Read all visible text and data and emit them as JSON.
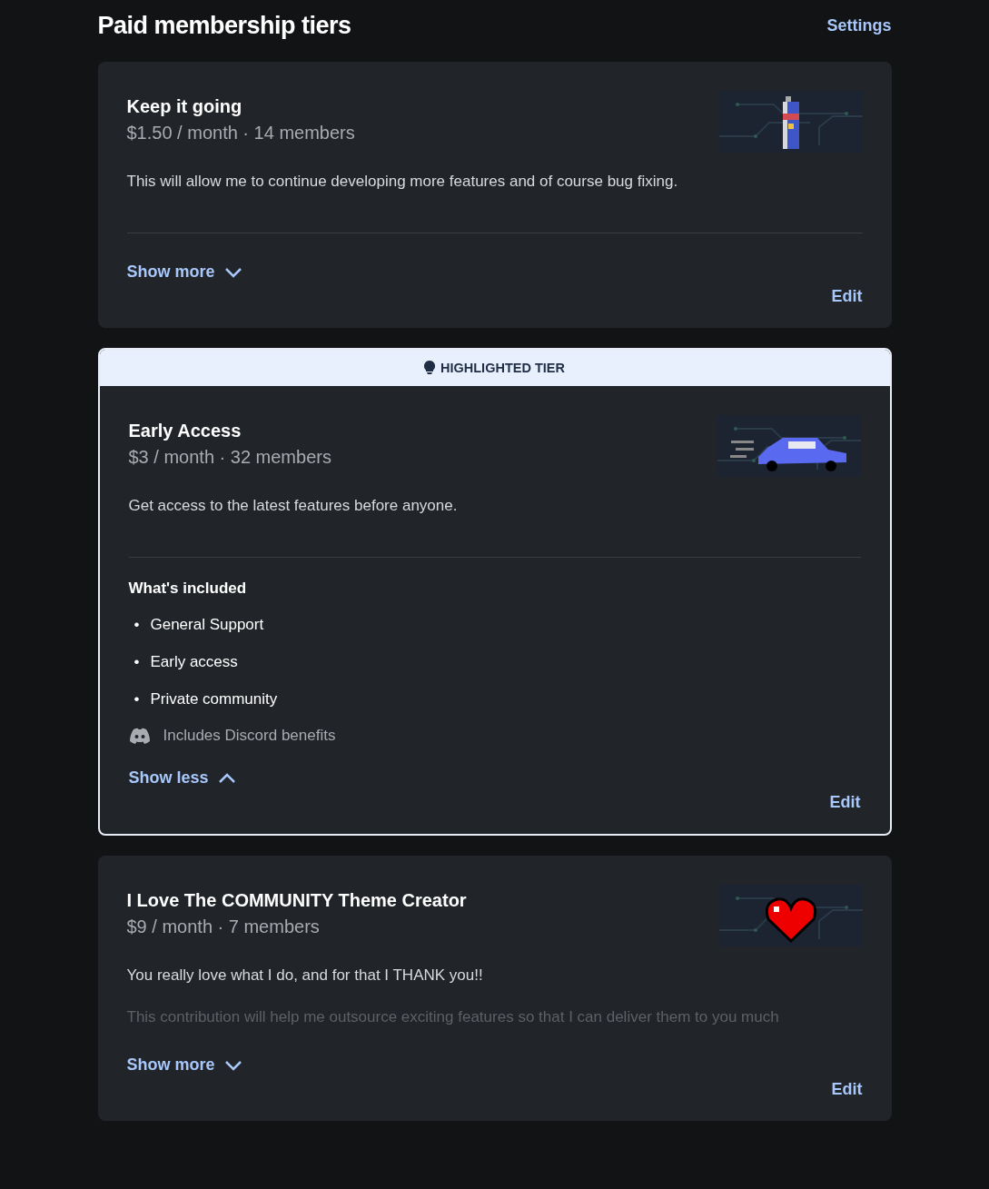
{
  "header": {
    "title": "Paid membership tiers",
    "settings_link": "Settings"
  },
  "tiers": [
    {
      "name": "Keep it going",
      "price": "$1.50 / month · 14 members",
      "description": "This will allow me to continue developing more features and of course bug fixing.",
      "highlighted": false,
      "expanded": false,
      "toggle": "Show more",
      "edit": "Edit"
    },
    {
      "highlight_label": "HIGHLIGHTED TIER",
      "name": "Early Access",
      "price": "$3 / month · 32 members",
      "description": "Get access to the latest features before anyone.",
      "highlighted": true,
      "expanded": true,
      "included_title": "What's included",
      "included": [
        {
          "bullet": "•",
          "text": "General Support"
        },
        {
          "bullet": "•",
          "text": "Early access"
        },
        {
          "bullet": "•",
          "text": "Private community"
        }
      ],
      "discord": "Includes Discord benefits",
      "toggle": "Show less",
      "edit": "Edit"
    },
    {
      "name": "I Love The COMMUNITY Theme Creator",
      "price": "$9 / month · 7 members",
      "description": "You really love what I do, and for that I THANK you!!",
      "faded_text": "This contribution will help me outsource exciting features so that I can deliver them to you much",
      "highlighted": false,
      "expanded": false,
      "toggle": "Show more",
      "edit": "Edit"
    }
  ]
}
